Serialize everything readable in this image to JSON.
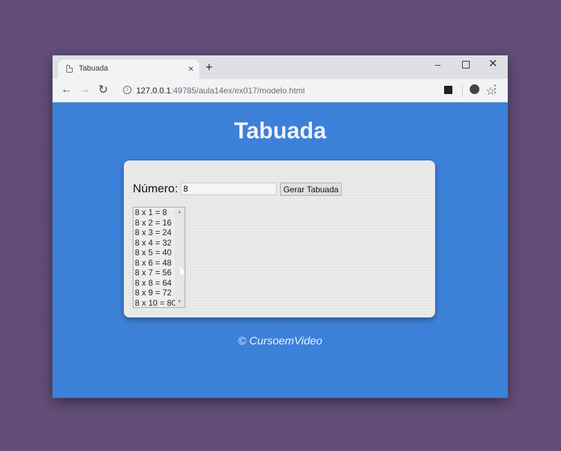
{
  "browser": {
    "tab_title": "Tabuada",
    "tab_close": "×",
    "new_tab": "+",
    "window_controls": {
      "minimize": "–",
      "close": "✕"
    },
    "url_host": "127.0.0.1",
    "url_path": ":49785/aula14ex/ex017/modelo.html"
  },
  "icons": {
    "back": "arrow-left-icon",
    "forward": "arrow-right-icon",
    "reload": "reload-icon",
    "info": "info-icon",
    "bookmark": "star-icon",
    "menu": "kebab-menu-icon"
  },
  "page": {
    "title": "Tabuada",
    "numero_label": "Número:",
    "numero_value": "8",
    "button_label": "Gerar Tabuada",
    "results": [
      "8 x 1 = 8",
      "8 x 2 = 16",
      "8 x 3 = 24",
      "8 x 4 = 32",
      "8 x 5 = 40",
      "8 x 6 = 48",
      "8 x 7 = 56",
      "8 x 8 = 64",
      "8 x 9 = 72",
      "8 x 10 = 80"
    ],
    "footer": "© CursoemVideo"
  },
  "colors": {
    "desktop": "#624c78",
    "page_background": "#3a7fd8",
    "card_background": "#e9ebea",
    "title_text": "#f0f2f6"
  }
}
